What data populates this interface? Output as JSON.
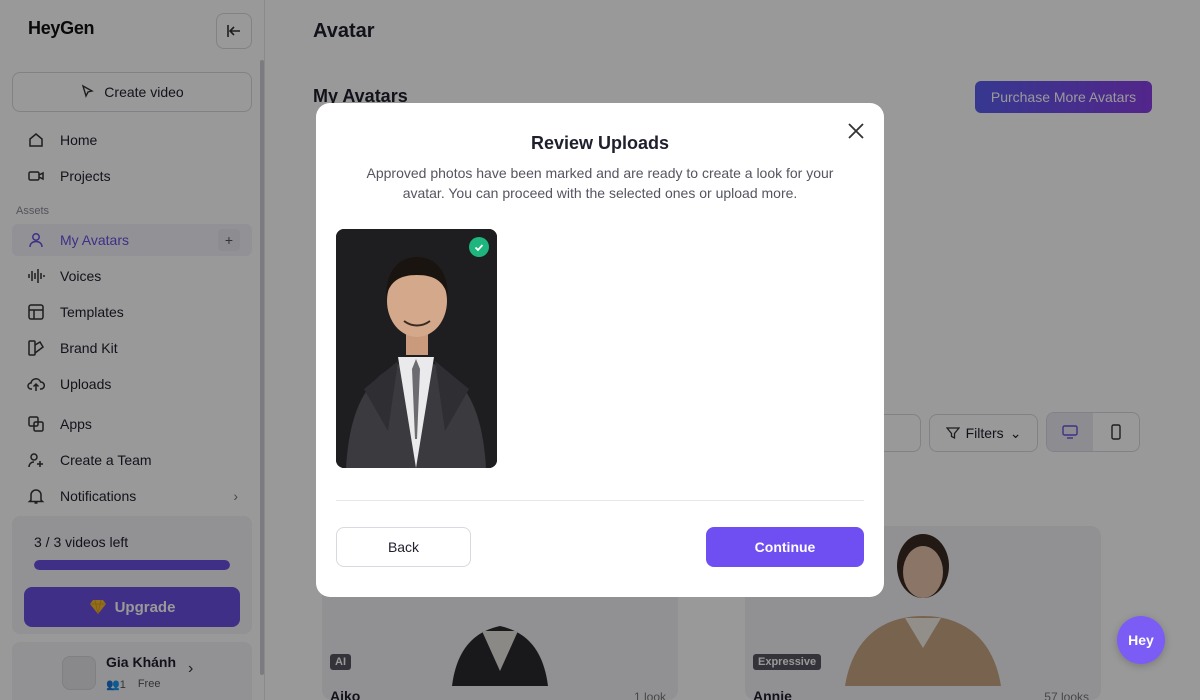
{
  "sidebar": {
    "logo": "HeyGen",
    "create_video": "Create video",
    "nav": [
      {
        "label": "Home",
        "icon": "home-icon"
      },
      {
        "label": "Projects",
        "icon": "video-camera-icon"
      }
    ],
    "assets_label": "Assets",
    "assets": [
      {
        "label": "My Avatars",
        "icon": "person-icon",
        "active": true
      },
      {
        "label": "Voices",
        "icon": "waveform-icon"
      },
      {
        "label": "Templates",
        "icon": "template-icon"
      },
      {
        "label": "Brand Kit",
        "icon": "brand-kit-icon"
      },
      {
        "label": "Uploads",
        "icon": "cloud-upload-icon"
      },
      {
        "label": "Apps",
        "icon": "apps-icon"
      },
      {
        "label": "Create a Team",
        "icon": "add-user-icon"
      },
      {
        "label": "Notifications",
        "icon": "bell-icon"
      }
    ],
    "quota": {
      "text": "3 / 3 videos left",
      "fraction": 1.0
    },
    "upgrade": "Upgrade",
    "user": {
      "name": "Gia Khánh",
      "members": "1",
      "plan": "Free"
    }
  },
  "main": {
    "title": "Avatar",
    "section_title": "My Avatars",
    "purchase": "Purchase More Avatars",
    "filters": "Filters",
    "cards": [
      {
        "name": "Aiko",
        "badge": "AI",
        "looks": "1 look"
      },
      {
        "name": "Annie",
        "badge": "Expressive",
        "looks": "57 looks"
      }
    ],
    "hey_fab": "Hey"
  },
  "modal": {
    "title": "Review Uploads",
    "description": "Approved photos have been marked and are ready to create a look for your avatar. You can proceed with the selected ones or upload more.",
    "back": "Back",
    "continue": "Continue"
  },
  "colors": {
    "accent": "#6f4ff2",
    "approved": "#1fb57e",
    "overlay": "rgba(0,0,0,0.40)"
  }
}
